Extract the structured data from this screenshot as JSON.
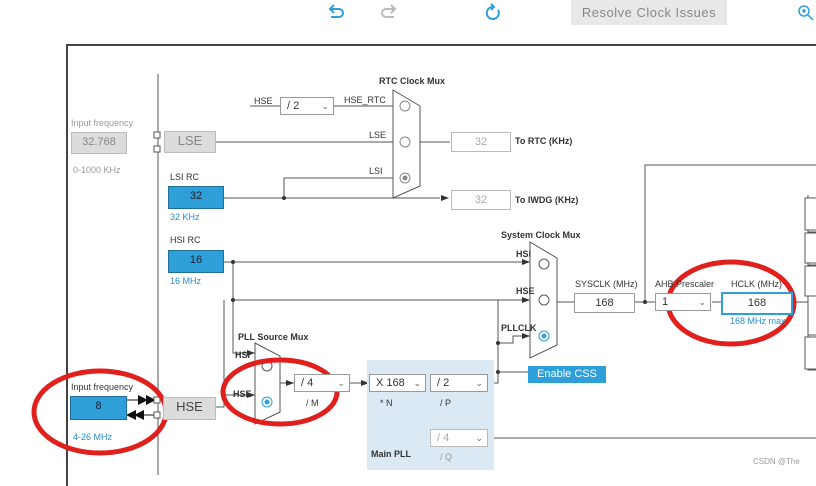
{
  "toolbar": {
    "undo_icon": "undo-arrow-icon",
    "redo_icon": "redo-arrow-icon",
    "refresh_icon": "refresh-icon",
    "zoom_icon": "zoom-in-icon",
    "resolve_label": "Resolve Clock Issues"
  },
  "lse": {
    "input_freq_label": "Input frequency",
    "value": "32.768",
    "range": "0-1000 KHz",
    "block_label": "LSE"
  },
  "lsi": {
    "title": "LSI RC",
    "value": "32",
    "unit": "32 KHz"
  },
  "hsi": {
    "title": "HSI RC",
    "value": "16",
    "unit": "16 MHz"
  },
  "hse": {
    "input_freq_label": "Input frequency",
    "value": "8",
    "range": "4-26 MHz",
    "block_label": "HSE"
  },
  "rtc_mux": {
    "title": "RTC Clock Mux",
    "hse_label": "HSE",
    "hse_div": "/ 2",
    "hse_rtc": "HSE_RTC",
    "lse": "LSE",
    "lsi": "LSI",
    "rtc_value": "32",
    "rtc_label": "To RTC (KHz)",
    "iwdg_value": "32",
    "iwdg_label": "To IWDG (KHz)"
  },
  "sys_mux": {
    "title": "System Clock Mux",
    "hsi": "HSI",
    "hse": "HSE",
    "pllclk": "PLLCLK",
    "enable_css": "Enable CSS"
  },
  "sysclk": {
    "label": "SYSCLK (MHz)",
    "value": "168"
  },
  "ahb": {
    "label": "AHB Prescaler",
    "value": "1"
  },
  "hclk": {
    "label": "HCLK (MHz)",
    "value": "168",
    "max": "168 MHz max"
  },
  "pll_src": {
    "title": "PLL Source Mux",
    "hsi": "HSI",
    "hse": "HSE",
    "m_value": "/ 4",
    "m_label": "/ M"
  },
  "main_pll": {
    "title": "Main PLL",
    "n_value": "X 168",
    "n_label": "* N",
    "p_value": "/ 2",
    "p_label": "/ P",
    "q_value": "/ 4",
    "q_label": "/ Q"
  },
  "watermark": "CSDN @The",
  "colors": {
    "accent": "#2e9fd9",
    "highlight": "#e0201c",
    "pll_bg": "#dbe9f5"
  }
}
